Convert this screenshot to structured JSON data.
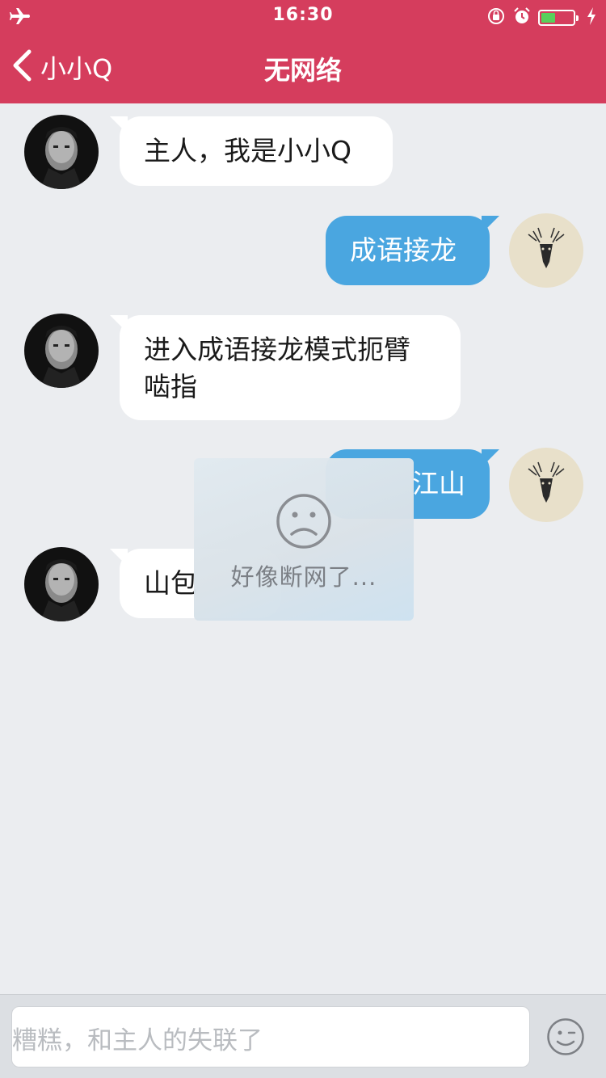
{
  "status_bar": {
    "time": "16:30",
    "icons": [
      "airplane-icon",
      "rotation-lock-icon",
      "alarm-icon",
      "battery-icon",
      "charging-icon"
    ],
    "battery_level": 0.45,
    "battery_color": "#58d05b"
  },
  "nav": {
    "back_label": "小小Q",
    "title": "无网络",
    "bar_color": "#d53d5d"
  },
  "messages": [
    {
      "from": "bot",
      "text": "主人，我是小小Q"
    },
    {
      "from": "user",
      "text": "成语接龙"
    },
    {
      "from": "bot",
      "text_lines": [
        "进入成语接龙模式扼臂",
        "啮指"
      ]
    },
    {
      "from": "user",
      "text": "江山"
    },
    {
      "from": "bot",
      "text": "山包"
    }
  ],
  "toast": {
    "icon": "sad-face-icon",
    "text": "好像断网了..."
  },
  "input": {
    "placeholder": "糟糕，和主人的失联了",
    "emoji_icon": "wink-emoji-icon"
  },
  "colors": {
    "user_bubble": "#4aa6e0",
    "bot_bubble": "#ffffff",
    "background": "#ebedf0"
  }
}
